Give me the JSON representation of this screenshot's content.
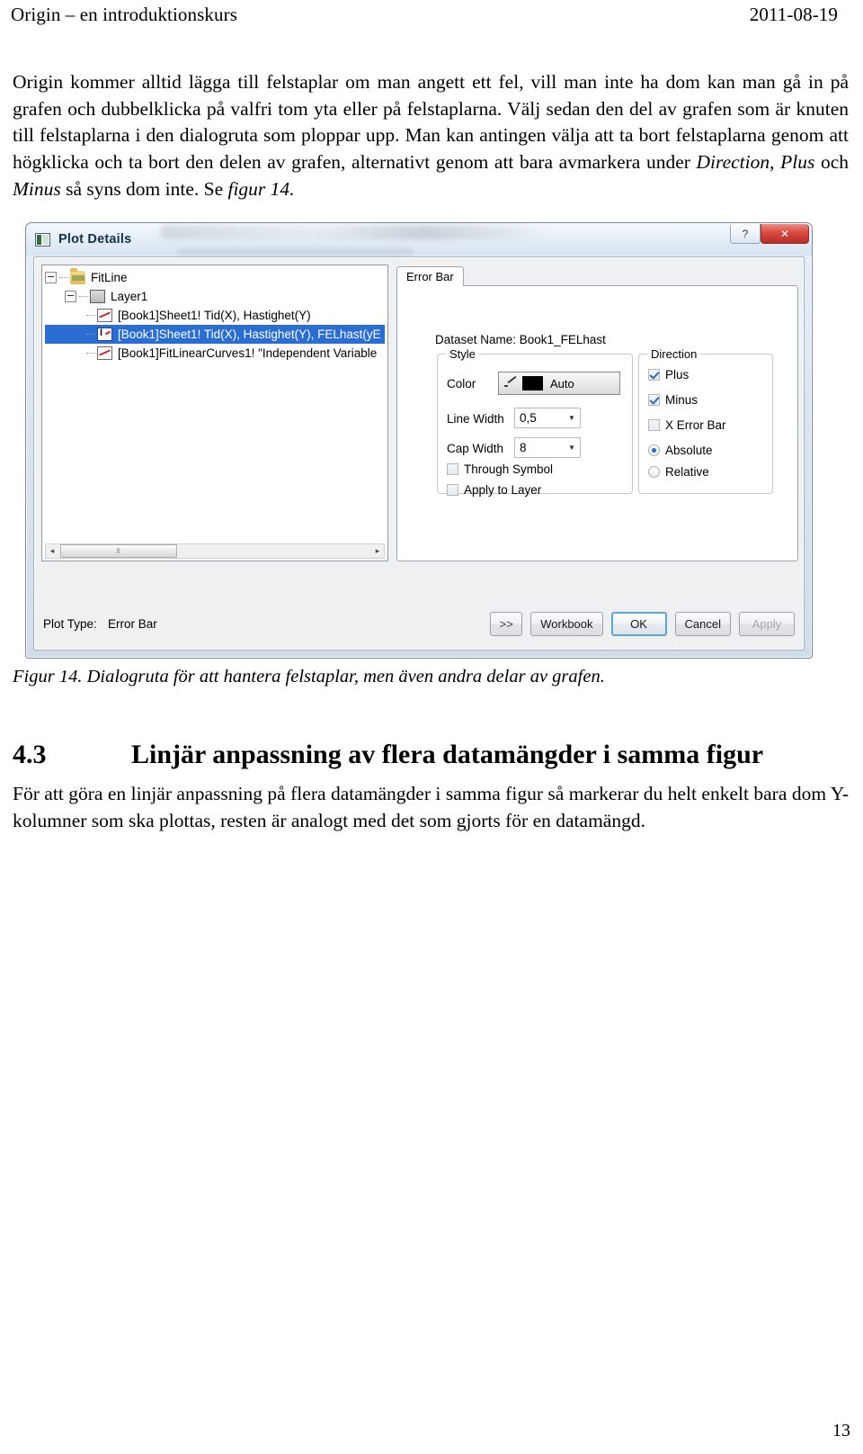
{
  "header": {
    "title": "Origin – en introduktionskurs",
    "date": "2011-08-19"
  },
  "intro_paragraph": {
    "part1": "Origin kommer alltid lägga till felstaplar om man angett ett fel, vill man inte ha dom kan man gå in på grafen och dubbelklicka på valfri tom yta eller på felstaplarna. Välj sedan den del av grafen som är knuten till felstaplarna i den dialogruta som ploppar upp. Man kan antingen välja att ta bort felstaplarna genom att högklicka och ta bort den delen av grafen, alternativt genom att bara avmarkera under ",
    "italic1": "Direction",
    "part2": ", ",
    "italic2": "Plus",
    "part3": " och ",
    "italic3": "Minus",
    "part4": " så syns dom inte. Se ",
    "italic4": "figur 14."
  },
  "dialog": {
    "title": "Plot Details",
    "window_buttons": {
      "help": "?",
      "close": "✕"
    },
    "tree": {
      "nodes": [
        {
          "label": "FitLine",
          "icon": "folder-icon",
          "level": 0,
          "expander": "collapse",
          "selected": false
        },
        {
          "label": "Layer1",
          "icon": "layer-icon",
          "level": 1,
          "expander": "collapse",
          "selected": false
        },
        {
          "label": "[Book1]Sheet1! Tid(X), Hastighet(Y)",
          "icon": "line-plot-icon",
          "level": 2,
          "expander": "none",
          "selected": false
        },
        {
          "label": "[Book1]Sheet1! Tid(X), Hastighet(Y), FELhast(yE",
          "icon": "error-bar-plot-icon",
          "level": 2,
          "expander": "none",
          "selected": true
        },
        {
          "label": "[Book1]FitLinearCurves1! \"Independent Variable",
          "icon": "line-plot-icon",
          "level": 2,
          "expander": "none",
          "selected": false
        }
      ],
      "hscroll": {
        "left_arrow": "◂",
        "right_arrow": "▸",
        "grip": "‖"
      }
    },
    "tab": {
      "label": "Error Bar"
    },
    "dataset_name": "Dataset Name: Book1_FELhast",
    "style_group": {
      "legend": "Style",
      "color_label": "Color",
      "color_value": "Auto",
      "color_swatch": "#000000",
      "line_width_label": "Line Width",
      "line_width_value": "0,5",
      "cap_width_label": "Cap Width",
      "cap_width_value": "8",
      "through_symbol_label": "Through Symbol",
      "through_symbol_checked": false,
      "apply_to_layer_label": "Apply to Layer",
      "apply_to_layer_checked": false,
      "caret": "▼"
    },
    "direction_group": {
      "legend": "Direction",
      "plus_label": "Plus",
      "plus_checked": true,
      "minus_label": "Minus",
      "minus_checked": true,
      "x_error_bar_label": "X Error Bar",
      "x_error_bar_checked": false,
      "absolute_label": "Absolute",
      "absolute_selected": true,
      "relative_label": "Relative",
      "relative_selected": false
    },
    "footer": {
      "plot_type_label": "Plot Type:",
      "plot_type_value": "Error Bar",
      "expand_button": ">>",
      "workbook_button": "Workbook",
      "ok_button": "OK",
      "cancel_button": "Cancel",
      "apply_button": "Apply"
    },
    "colors": {
      "selection_blue": "#2a6ed4",
      "close_red": "#d84a41",
      "focus_outline": "#5ba8d8",
      "titlebar_text": "#12314f"
    }
  },
  "figure_caption": "Figur 14. Dialogruta för att hantera felstaplar, men även andra delar av grafen.",
  "section": {
    "number": "4.3",
    "title": "Linjär anpassning av flera datamängder i samma figur",
    "paragraph": "För att göra en linjär anpassning på flera datamängder i samma figur så markerar du helt enkelt bara dom Y-kolumner som ska plottas, resten är analogt med det som gjorts för en datamängd."
  },
  "page_number": "13"
}
